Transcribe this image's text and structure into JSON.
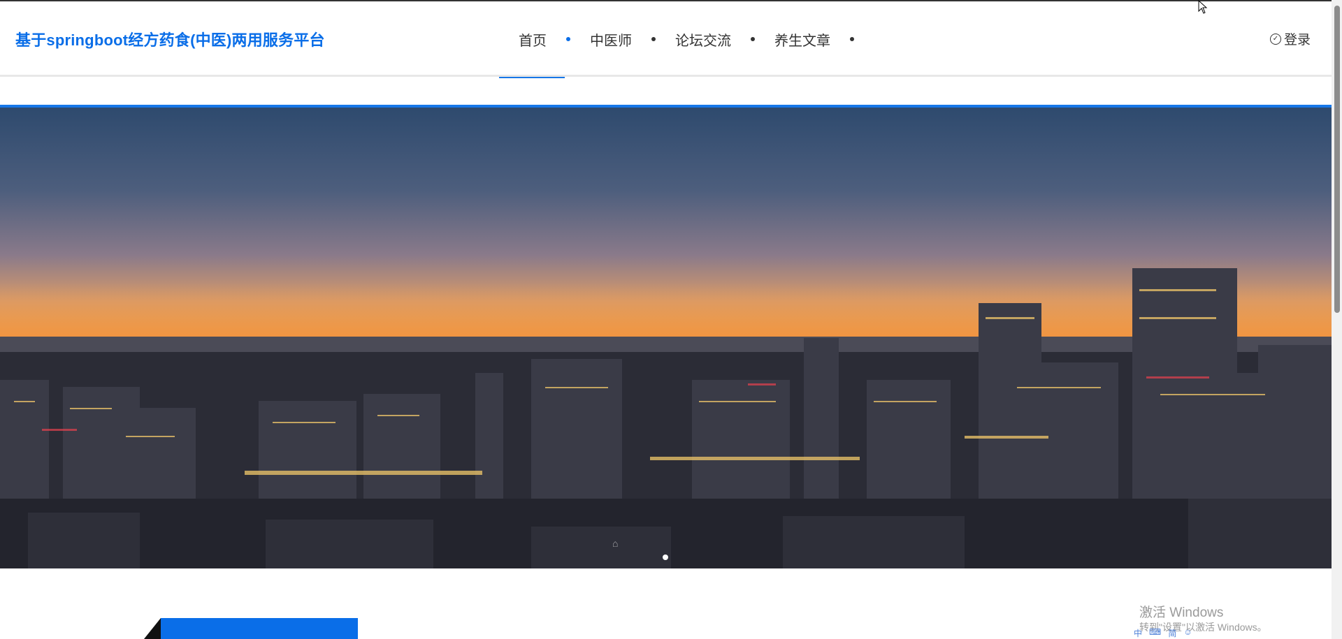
{
  "header": {
    "site_title": "基于springboot经方药食(中医)两用服务平台",
    "nav": [
      {
        "label": "首页",
        "active": true
      },
      {
        "label": "中医师",
        "active": false
      },
      {
        "label": "论坛交流",
        "active": false
      },
      {
        "label": "养生文章",
        "active": false
      }
    ],
    "login_label": "登录",
    "login_icon": "check-circle-icon"
  },
  "banner": {
    "carousel_total": 1,
    "carousel_active": 1,
    "image_subject": "city skyline at dusk"
  },
  "system_overlay": {
    "activate_title": "激活 Windows",
    "activate_sub": "转到\"设置\"以激活 Windows。",
    "ime_items": [
      "中",
      "⌨",
      "简",
      "☺"
    ]
  },
  "colors": {
    "accent": "#0a6ee8",
    "text": "#333333",
    "divider": "#e8e8e8"
  }
}
